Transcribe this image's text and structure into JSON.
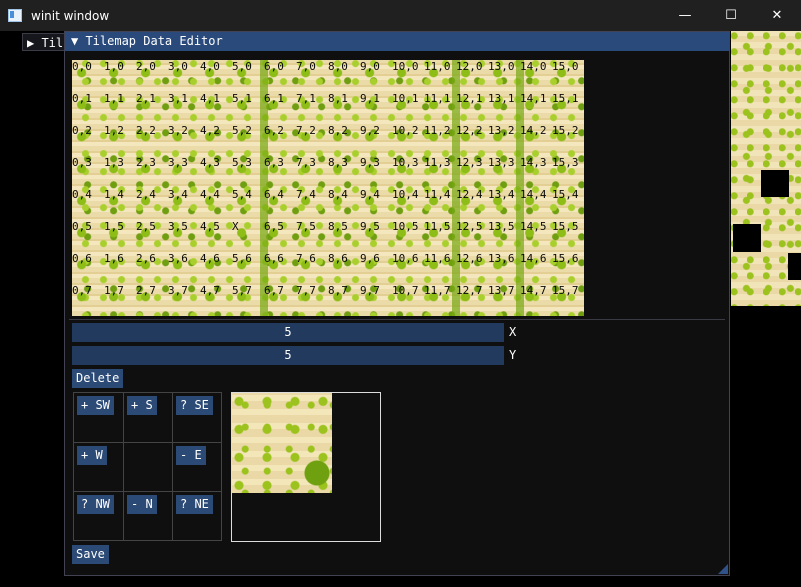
{
  "window": {
    "title": "winit window",
    "min_glyph": "—",
    "max_glyph": "☐",
    "close_glyph": "✕"
  },
  "background_window": {
    "title": "▶ Til"
  },
  "editor": {
    "title": "▼ Tilemap Data Editor",
    "tile_rows": [
      [
        "0,0",
        "1,0",
        "2,0",
        "3,0",
        "4,0",
        "5,0",
        "6,0",
        "7,0",
        "8,0",
        "9,0",
        "10,0",
        "11,0",
        "12,0",
        "13,0",
        "14,0",
        "15,0"
      ],
      [
        "0,1",
        "1,1",
        "2,1",
        "3,1",
        "4,1",
        "5,1",
        "6,1",
        "7,1",
        "8,1",
        "9,1",
        "10,1",
        "11,1",
        "12,1",
        "13,1",
        "14,1",
        "15,1"
      ],
      [
        "0,2",
        "1,2",
        "2,2",
        "3,2",
        "4,2",
        "5,2",
        "6,2",
        "7,2",
        "8,2",
        "9,2",
        "10,2",
        "11,2",
        "12,2",
        "13,2",
        "14,2",
        "15,2"
      ],
      [
        "0,3",
        "1,3",
        "2,3",
        "3,3",
        "4,3",
        "5,3",
        "6,3",
        "7,3",
        "8,3",
        "9,3",
        "10,3",
        "11,3",
        "12,3",
        "13,3",
        "14,3",
        "15,3"
      ],
      [
        "0,4",
        "1,4",
        "2,4",
        "3,4",
        "4,4",
        "5,4",
        "6,4",
        "7,4",
        "8,4",
        "9,4",
        "10,4",
        "11,4",
        "12,4",
        "13,4",
        "14,4",
        "15,4"
      ],
      [
        "0,5",
        "1,5",
        "2,5",
        "3,5",
        "4,5",
        "X",
        "6,5",
        "7,5",
        "8,5",
        "9,5",
        "10,5",
        "11,5",
        "12,5",
        "13,5",
        "14,5",
        "15,5"
      ],
      [
        "0,6",
        "1,6",
        "2,6",
        "3,6",
        "4,6",
        "5,6",
        "6,6",
        "7,6",
        "8,6",
        "9,6",
        "10,6",
        "11,6",
        "12,6",
        "13,6",
        "14,6",
        "15,6"
      ],
      [
        "0,7",
        "1,7",
        "2,7",
        "3,7",
        "4,7",
        "5,7",
        "6,7",
        "7,7",
        "8,7",
        "9,7",
        "10,7",
        "11,7",
        "12,7",
        "13,7",
        "14,7",
        "15,7"
      ]
    ],
    "x_value": "5",
    "x_label": "X",
    "y_value": "5",
    "y_label": "Y",
    "delete_label": "Delete",
    "directions": {
      "sw": "+ SW",
      "s": "+ S",
      "se": "? SE",
      "w": "+ W",
      "e": "- E",
      "nw": "? NW",
      "n": "- N",
      "ne": "? NE"
    },
    "save_label": "Save"
  }
}
